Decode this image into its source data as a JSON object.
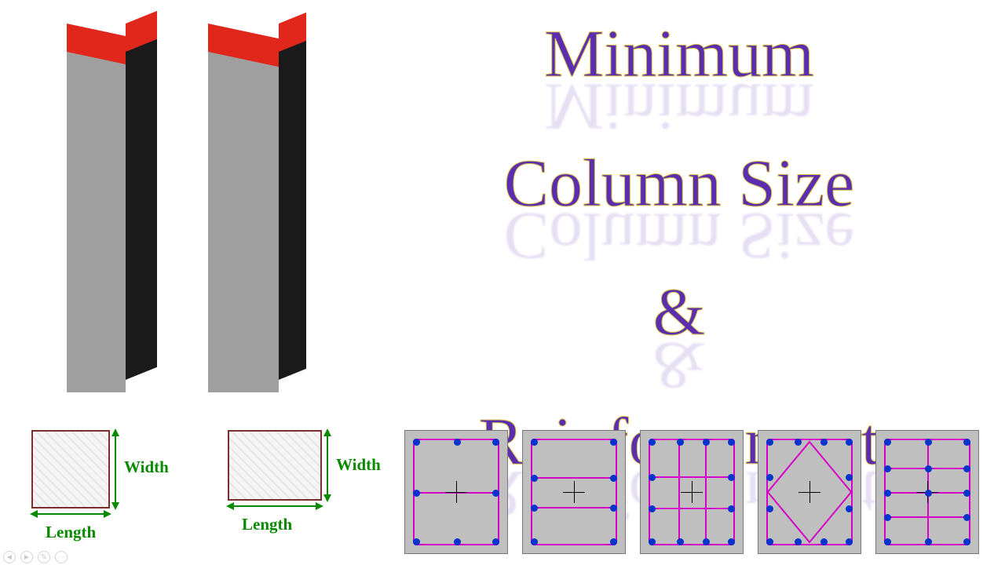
{
  "title": {
    "line1": "Minimum",
    "line2": "Column Size",
    "line3": "&",
    "line4": "Reinforcement"
  },
  "plan_labels": {
    "width": "Width",
    "length": "Length"
  },
  "colors": {
    "title_fill": "#5b2db0",
    "title_outline": "#d8c24a",
    "dim_green": "#0a8a00",
    "column_top": "#e1261c",
    "column_face": "#9f9f9f",
    "column_side": "#1a1a1a",
    "tie_magenta": "#d400c8",
    "rebar_blue": "#0033cc",
    "section_bg": "#bfbfbf"
  },
  "sections": [
    {
      "name": "8-bar-simple",
      "bars": 8,
      "inner_ties": "middle-h"
    },
    {
      "name": "8-bar-double",
      "bars": 8,
      "inner_ties": "two-h"
    },
    {
      "name": "12-bar-grid",
      "bars": 12,
      "inner_ties": "grid"
    },
    {
      "name": "12-bar-diamond",
      "bars": 12,
      "inner_ties": "diamond"
    },
    {
      "name": "14-bar-multi",
      "bars": 14,
      "inner_ties": "multi"
    }
  ],
  "icons": {
    "column_square": "square-column-icon",
    "column_rect": "rect-column-icon"
  }
}
